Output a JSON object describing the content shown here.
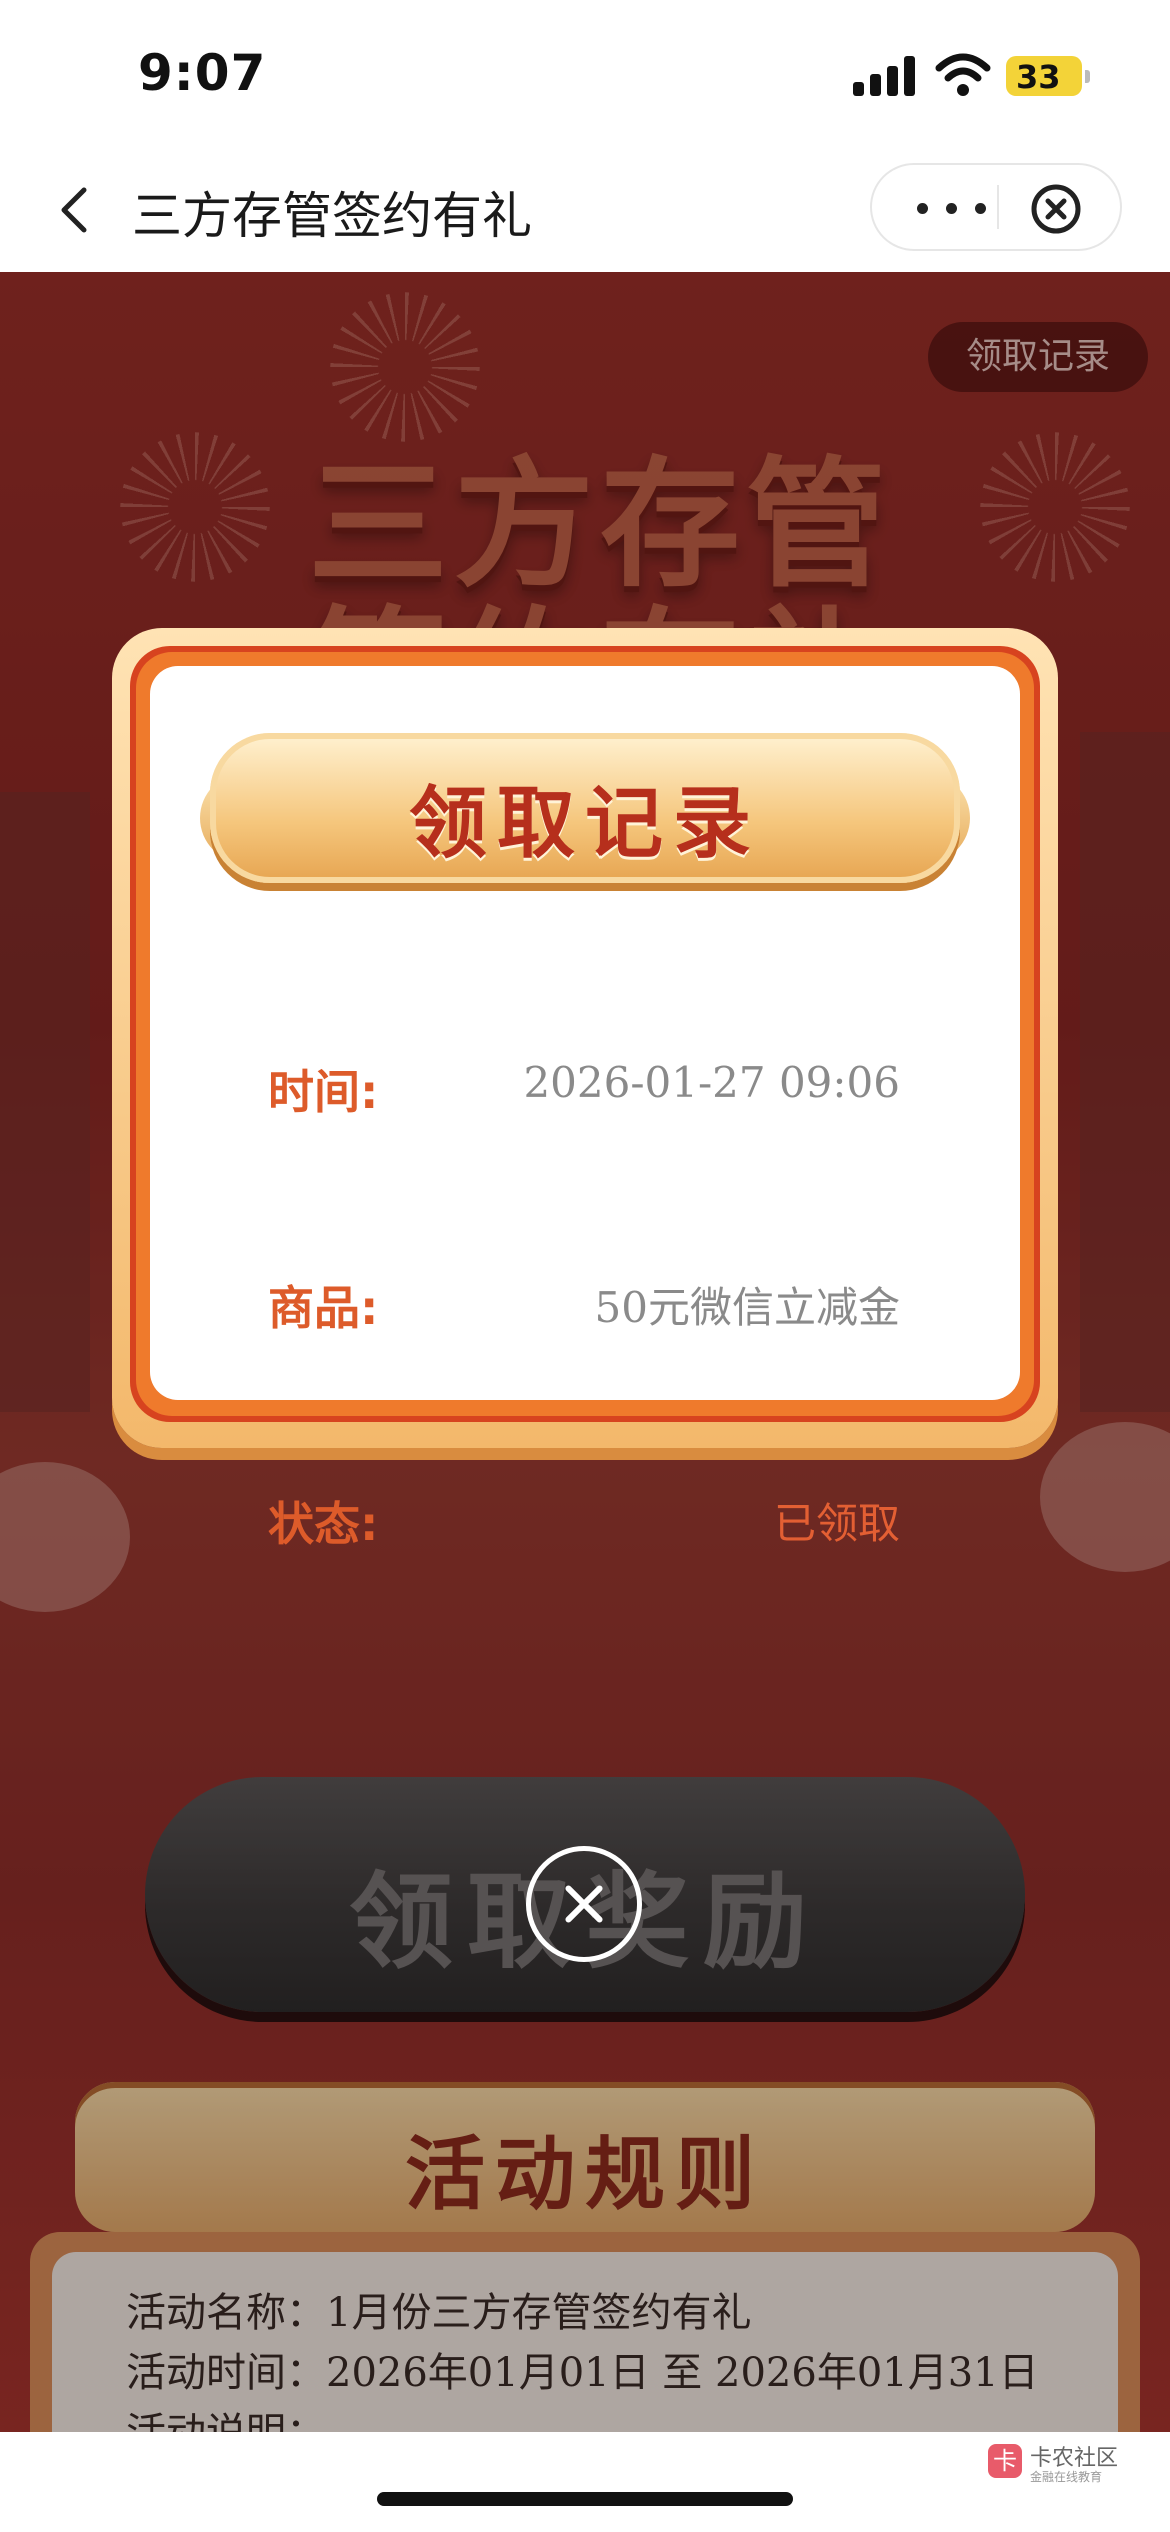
{
  "status_bar": {
    "time": "9:07",
    "battery": "33"
  },
  "nav": {
    "title": "三方存管签约有礼",
    "back_icon": "chevron-left-icon",
    "more_icon": "more-dots-icon",
    "close_icon": "close-circle-icon"
  },
  "page": {
    "record_button": "领取记录",
    "bg_title_line1": "三方存管",
    "bg_title_line2": "签约有礼",
    "claim_button": "领取奖励",
    "rules_title": "活动规则",
    "rules": [
      "活动名称：1月份三方存管签约有礼",
      "活动时间：2026年01月01日 至 2026年01月31日",
      "活动说明："
    ]
  },
  "modal": {
    "title": "领取记录",
    "rows": [
      {
        "label": "时间:",
        "value": "2026-01-27 09:06"
      },
      {
        "label": "商品:",
        "value": "50元微信立减金"
      },
      {
        "label": "状态:",
        "value": "已领取"
      }
    ],
    "close_icon": "close-circle-icon"
  },
  "watermark": {
    "name": "卡农社区",
    "tagline": "金融在线教育"
  },
  "colors": {
    "accent": "#dd5b2a",
    "page_bg": "#8a2623",
    "modal_frame": "#d7431f"
  }
}
